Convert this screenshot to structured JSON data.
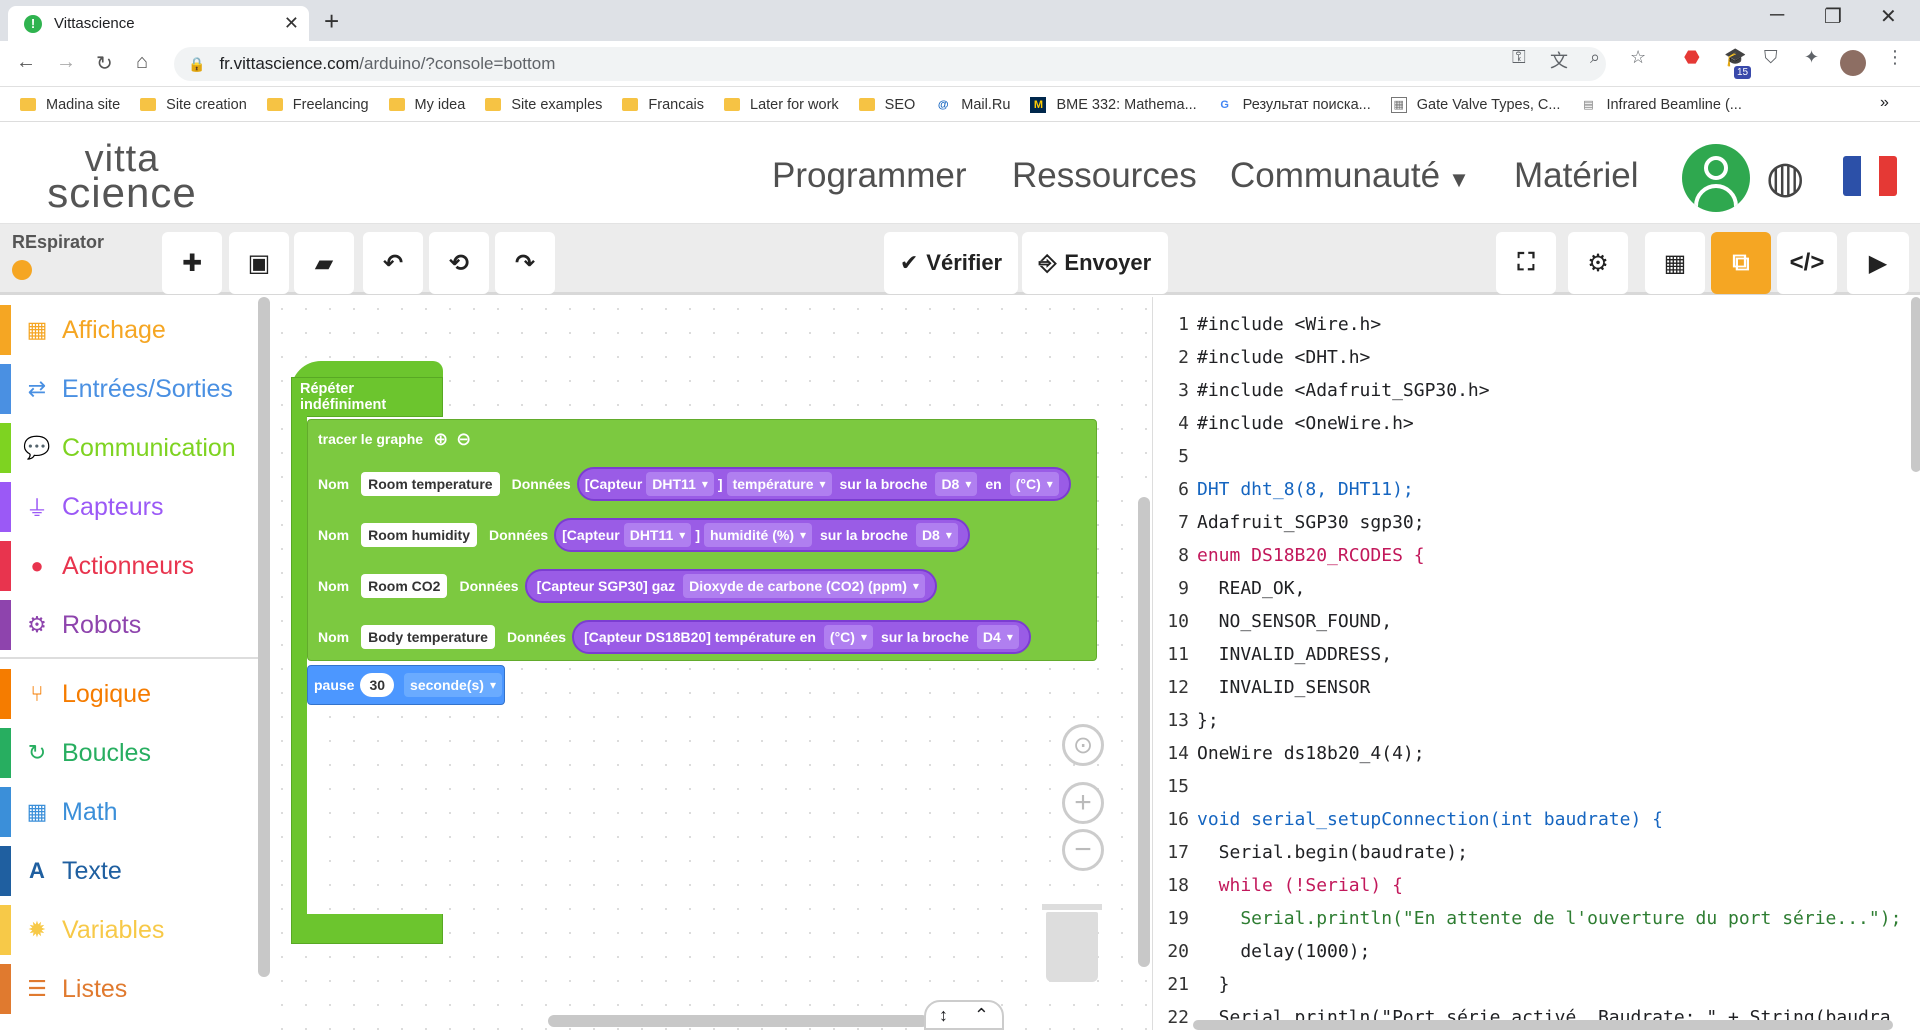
{
  "browser": {
    "tab_title": "Vittascience",
    "url_host": "fr.vittascience.com",
    "url_path": "/arduino/?console=bottom",
    "bookmarks": [
      "Madina site",
      "Site creation",
      "Freelancing",
      "My idea",
      "Site examples",
      "Francais",
      "Later for work",
      "SEO",
      "Mail.Ru",
      "BME 332: Mathema...",
      "Результат поиска...",
      "Gate Valve Types, C...",
      "Infrared Beamline (..."
    ],
    "extension_badge": "15"
  },
  "site": {
    "logo_line1": "vitta",
    "logo_line2": "science",
    "menu": [
      "Programmer",
      "Ressources",
      "Communauté",
      "Matériel"
    ],
    "accent_color": "#f5a623",
    "brand_green": "#2fa84f"
  },
  "toolbar": {
    "project_name": "REspirator",
    "verify_label": "Vérifier",
    "send_label": "Envoyer"
  },
  "sidebar": {
    "categories": [
      {
        "label": "Affichage",
        "color": "#f5a623",
        "icon": "grid-icon"
      },
      {
        "label": "Entrées/Sorties",
        "color": "#4a90e2",
        "icon": "arrows-icon"
      },
      {
        "label": "Communication",
        "color": "#7ed321",
        "icon": "chat-icon"
      },
      {
        "label": "Capteurs",
        "color": "#9b59f6",
        "icon": "plug-icon"
      },
      {
        "label": "Actionneurs",
        "color": "#e8344e",
        "icon": "bulb-icon"
      },
      {
        "label": "Robots",
        "color": "#8e44ad",
        "icon": "robot-icon"
      },
      {
        "label": "Logique",
        "color": "#f57c00",
        "icon": "branch-icon"
      },
      {
        "label": "Boucles",
        "color": "#27ae60",
        "icon": "loop-icon"
      },
      {
        "label": "Math",
        "color": "#3b8fd9",
        "icon": "calculator-icon"
      },
      {
        "label": "Texte",
        "color": "#1f5fa0",
        "icon": "text-icon"
      },
      {
        "label": "Variables",
        "color": "#f7c948",
        "icon": "gear-icon"
      },
      {
        "label": "Listes",
        "color": "#e07a2f",
        "icon": "list-icon"
      }
    ]
  },
  "blocks": {
    "repeat_label": "Répéter indéfiniment",
    "graph_label": "tracer le graphe",
    "nom": "Nom",
    "donnees": "Données",
    "rows": [
      {
        "name": "Room temperature",
        "parts": [
          "[Capteur",
          "DHT11",
          "]",
          "température",
          "sur la broche",
          "D8",
          "en",
          "(°C)"
        ]
      },
      {
        "name": "Room humidity",
        "parts": [
          "[Capteur",
          "DHT11",
          "]",
          "humidité (%)",
          "sur la broche",
          "D8"
        ]
      },
      {
        "name": "Room CO2",
        "parts": [
          "[Capteur SGP30] gaz",
          "Dioxyde de carbone (CO2) (ppm)"
        ]
      },
      {
        "name": "Body temperature",
        "parts": [
          "[Capteur DS18B20] température en",
          "(°C)",
          "sur la broche",
          "D4"
        ]
      }
    ],
    "pause_label": "pause",
    "pause_value": "30",
    "pause_unit": "seconde(s)"
  },
  "code_lines": [
    "#include <Wire.h>",
    "#include <DHT.h>",
    "#include <Adafruit_SGP30.h>",
    "#include <OneWire.h>",
    "",
    "DHT dht_8(8, DHT11);",
    "Adafruit_SGP30 sgp30;",
    "enum DS18B20_RCODES {",
    "  READ_OK,",
    "  NO_SENSOR_FOUND,",
    "  INVALID_ADDRESS,",
    "  INVALID_SENSOR",
    "};",
    "OneWire ds18b20_4(4);",
    "",
    "void serial_setupConnection(int baudrate) {",
    "  Serial.begin(baudrate);",
    "  while (!Serial) {",
    "    Serial.println(\"En attente de l'ouverture du port série...\");",
    "    delay(1000);",
    "  }",
    "  Serial.println(\"Port série activé. Baudrate: \" + String(baudra"
  ]
}
